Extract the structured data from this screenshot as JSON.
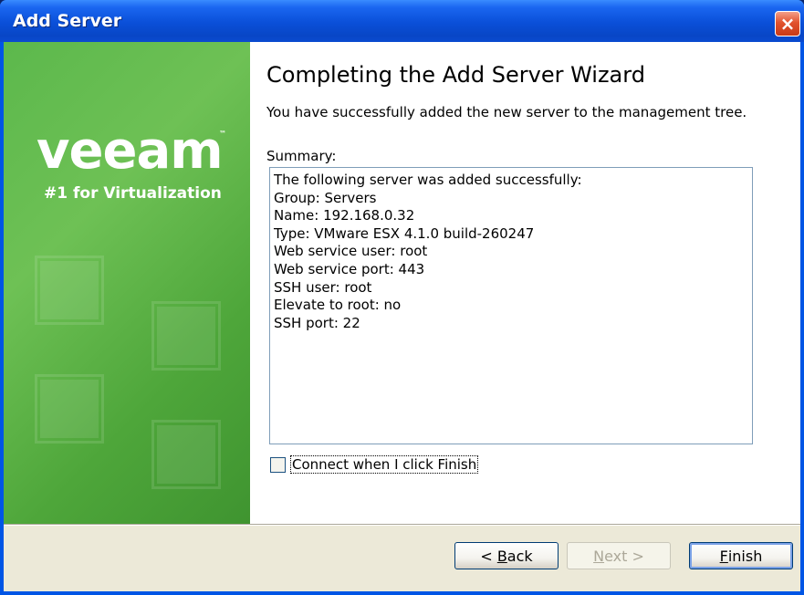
{
  "window": {
    "title": "Add Server",
    "close_glyph": "×"
  },
  "banner": {
    "logo": "veeam",
    "logo_tm": "™",
    "tagline": "#1 for Virtualization"
  },
  "wizard": {
    "heading": "Completing the Add Server Wizard",
    "subtitle": "You have successfully added the new server to the management tree.",
    "summary_label": "Summary:",
    "summary_lines": [
      "The following server was added successfully:",
      "Group: Servers",
      "Name: 192.168.0.32",
      "Type: VMware ESX 4.1.0 build-260247",
      "Web service user: root",
      "Web service port: 443",
      "SSH user: root",
      "Elevate to root: no",
      "SSH port: 22"
    ],
    "connect_checkbox": {
      "label": "Connect when I click Finish",
      "checked": false
    }
  },
  "buttons": {
    "back": {
      "prefix": "< ",
      "key": "B",
      "rest": "ack"
    },
    "next": {
      "key": "N",
      "rest": "ext >"
    },
    "finish": {
      "key": "F",
      "rest": "inish"
    }
  },
  "colors": {
    "titlebar": "#0a4fd8",
    "banner_green": "#5cb84c",
    "close_red": "#e2532e"
  }
}
